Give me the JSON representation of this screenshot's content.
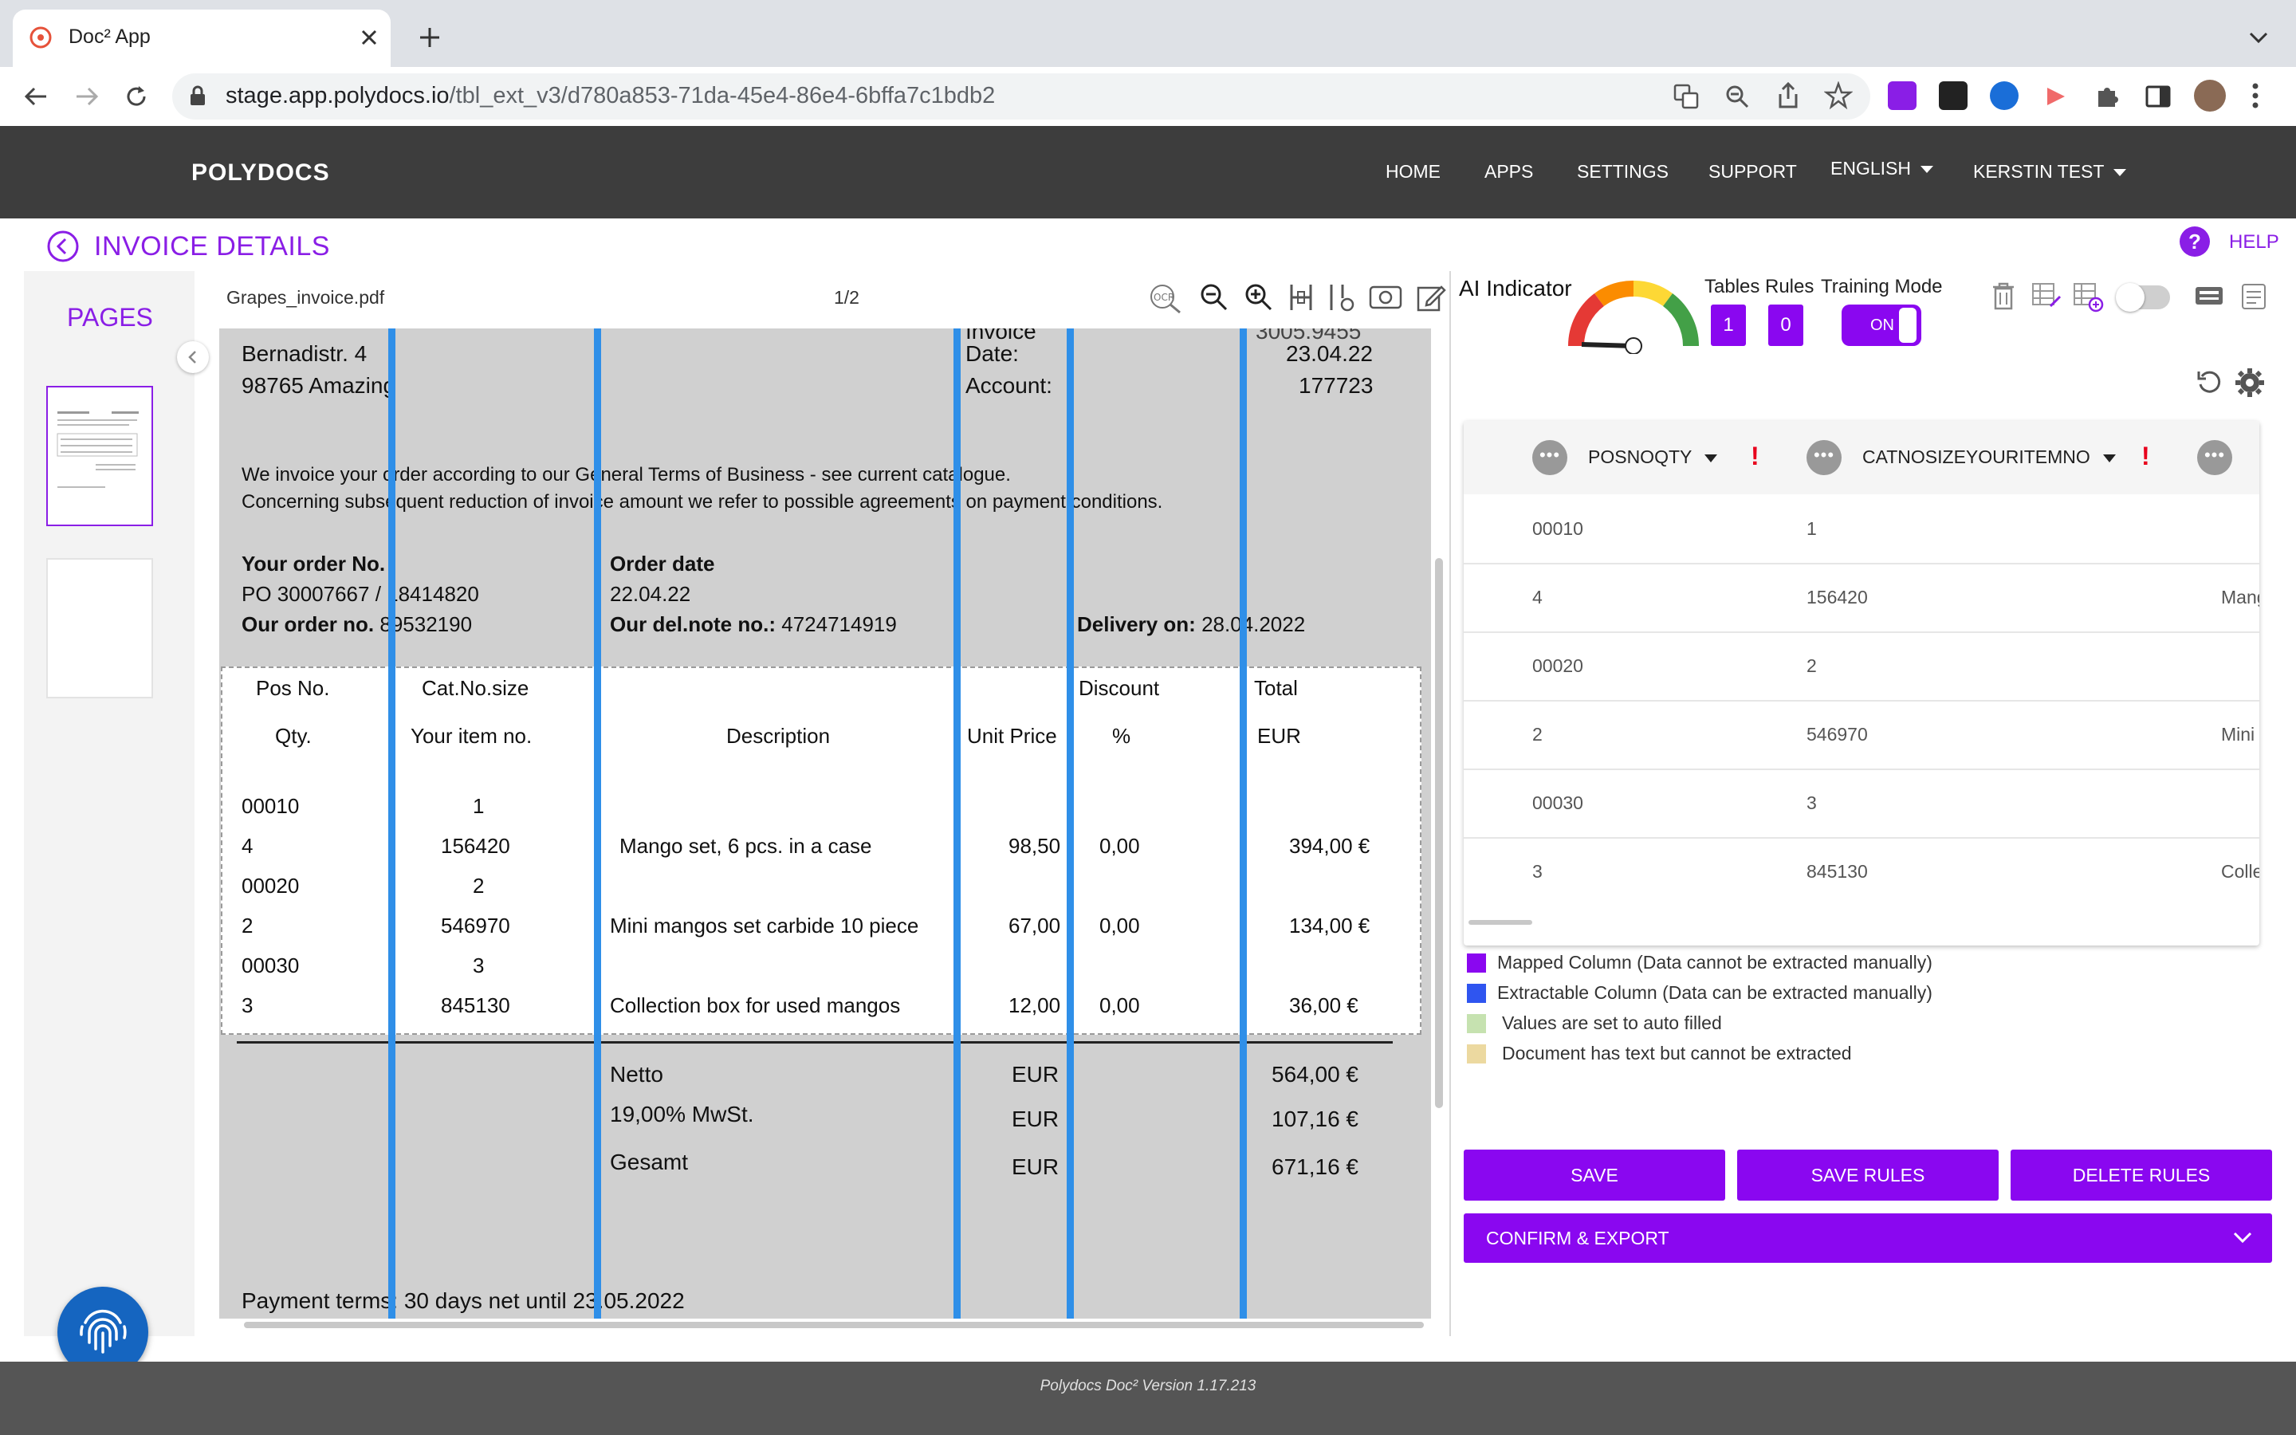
{
  "browser": {
    "tab_title": "Doc² App",
    "url_domain": "stage.app.polydocs.io",
    "url_path": "/tbl_ext_v3/d780a853-71da-45e4-86e4-6bffa7c1bdb2"
  },
  "nav": {
    "logo": "POLYDOCS",
    "items": [
      "HOME",
      "APPS",
      "SETTINGS",
      "SUPPORT",
      "ENGLISH",
      "KERSTIN TEST"
    ]
  },
  "header": {
    "title": "INVOICE DETAILS",
    "help": "HELP"
  },
  "pages_panel": {
    "title": "PAGES"
  },
  "viewer": {
    "filename": "Grapes_invoice.pdf",
    "page_indicator": "1/2",
    "ocr_label": "OCR"
  },
  "document": {
    "address_line1": "Bernadistr. 4",
    "address_line2": "98765 Amazing",
    "cut_label": "Invoice",
    "date_label": "Date:",
    "date_value": "23.04.22",
    "account_label": "Account:",
    "account_value": "177723",
    "intro_line1": "We invoice your order according to our General Terms of Business - see current catalogue.",
    "intro_line2": "Concerning subsequent reduction of invoice amount we refer to possible agreements on payment conditions.",
    "your_order_label": "Your order No.",
    "your_order_value": "PO 30007667 / 18414820",
    "our_order_label": "Our order no.",
    "our_order_value": "89532190",
    "order_date_label": "Order date",
    "order_date_value": "22.04.22",
    "delnote_label": "Our del.note no.:",
    "delnote_value": "4724714919",
    "delivery_label": "Delivery on:",
    "delivery_value": "28.04.2022",
    "table_headers": {
      "pos": "Pos No.",
      "qty": "Qty.",
      "cat": "Cat.No.size",
      "item": "Your item no.",
      "desc": "Description",
      "unit": "Unit Price",
      "disc": "Discount",
      "pct": "%",
      "total": "Total",
      "eur": "EUR"
    },
    "rows": [
      {
        "c1": "00010",
        "c2": "1",
        "c3": "",
        "c4": "",
        "c5": "",
        "c6": ""
      },
      {
        "c1": "4",
        "c2": "156420",
        "c3": "Mango set, 6 pcs. in a case",
        "c4": "98,50",
        "c5": "0,00",
        "c6": "394,00 €"
      },
      {
        "c1": "00020",
        "c2": "2",
        "c3": "",
        "c4": "",
        "c5": "",
        "c6": ""
      },
      {
        "c1": "2",
        "c2": "546970",
        "c3": "Mini mangos set carbide 10 piece",
        "c4": "67,00",
        "c5": "0,00",
        "c6": "134,00 €"
      },
      {
        "c1": "00030",
        "c2": "3",
        "c3": "",
        "c4": "",
        "c5": "",
        "c6": ""
      },
      {
        "c1": "3",
        "c2": "845130",
        "c3": "Collection box for used mangos",
        "c4": "12,00",
        "c5": "0,00",
        "c6": "36,00 €"
      }
    ],
    "totals": [
      {
        "label": "Netto",
        "cur": "EUR",
        "value": "564,00 €"
      },
      {
        "label": "19,00% MwSt.",
        "cur": "EUR",
        "value": "107,16 €"
      },
      {
        "label": "Gesamt",
        "cur": "EUR",
        "value": "671,16 €"
      }
    ],
    "payment_terms": "Payment terms: 30 days net until 23.05.2022"
  },
  "ai_panel": {
    "ai_indicator": "AI Indicator",
    "tables_label": "Tables",
    "tables_value": "1",
    "rules_label": "Rules",
    "rules_value": "0",
    "training_label": "Training Mode",
    "training_toggle": "ON"
  },
  "grid": {
    "columns": [
      "POSNOQTY",
      "CATNOSIZEYOURITEMNO"
    ],
    "rows": [
      {
        "a": "00010",
        "b": "1",
        "c": ""
      },
      {
        "a": "4",
        "b": "156420",
        "c": "Mang"
      },
      {
        "a": "00020",
        "b": "2",
        "c": ""
      },
      {
        "a": "2",
        "b": "546970",
        "c": "Mini"
      },
      {
        "a": "00030",
        "b": "3",
        "c": ""
      },
      {
        "a": "3",
        "b": "845130",
        "c": "Colle"
      }
    ]
  },
  "legend": [
    {
      "text": "Mapped Column (Data cannot be extracted manually)",
      "color": "#8a07f0"
    },
    {
      "text": "Extractable Column (Data can be extracted manually)",
      "color": "#2f55f0"
    },
    {
      "text": "Values are set to auto filled",
      "color": "#c6e2b0"
    },
    {
      "text": "Document has text but cannot be extracted",
      "color": "#ecd9a0"
    }
  ],
  "buttons": {
    "save": "SAVE",
    "save_rules": "SAVE RULES",
    "delete_rules": "DELETE RULES",
    "confirm_export": "CONFIRM & EXPORT"
  },
  "footer": {
    "version": "Polydocs Doc² Version 1.17.213"
  },
  "colors": {
    "accent": "#8a07f0",
    "nav_bg": "#3d3d3d",
    "column_line": "#2f8fe8"
  }
}
